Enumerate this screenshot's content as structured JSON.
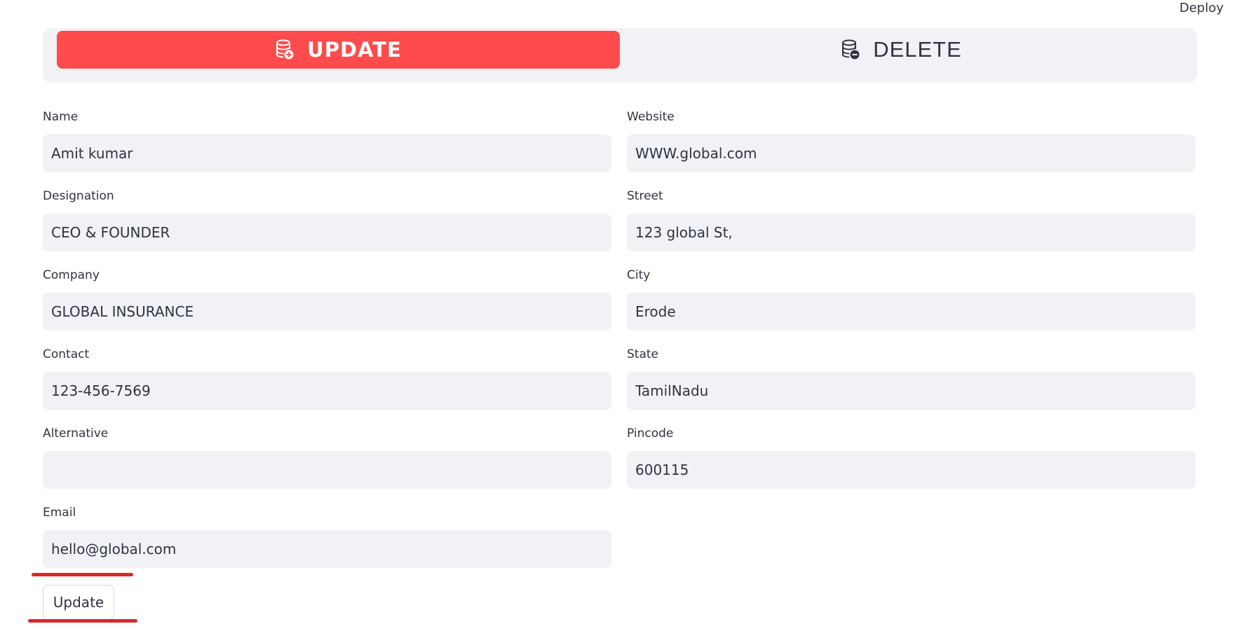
{
  "header": {
    "deploy_label": "Deploy"
  },
  "tabs": [
    {
      "label": "UPDATE",
      "icon": "database-add-icon",
      "active": true
    },
    {
      "label": "DELETE",
      "icon": "database-remove-icon",
      "active": false
    }
  ],
  "form": {
    "left": [
      {
        "label": "Name",
        "value": "Amit kumar"
      },
      {
        "label": "Designation",
        "value": "CEO & FOUNDER"
      },
      {
        "label": "Company",
        "value": "GLOBAL INSURANCE"
      },
      {
        "label": "Contact",
        "value": "123-456-7569"
      },
      {
        "label": "Alternative",
        "value": ""
      },
      {
        "label": "Email",
        "value": "hello@global.com"
      }
    ],
    "right": [
      {
        "label": "Website",
        "value": "WWW.global.com"
      },
      {
        "label": "Street",
        "value": "123 global St,"
      },
      {
        "label": "City",
        "value": "Erode"
      },
      {
        "label": "State",
        "value": "TamilNadu"
      },
      {
        "label": "Pincode",
        "value": "600115"
      }
    ],
    "submit_label": "Update"
  },
  "colors": {
    "accent": "#ff4b4b",
    "input_bg": "#f0f2f6",
    "text": "#31333f",
    "annotation": "#d62a2a"
  }
}
